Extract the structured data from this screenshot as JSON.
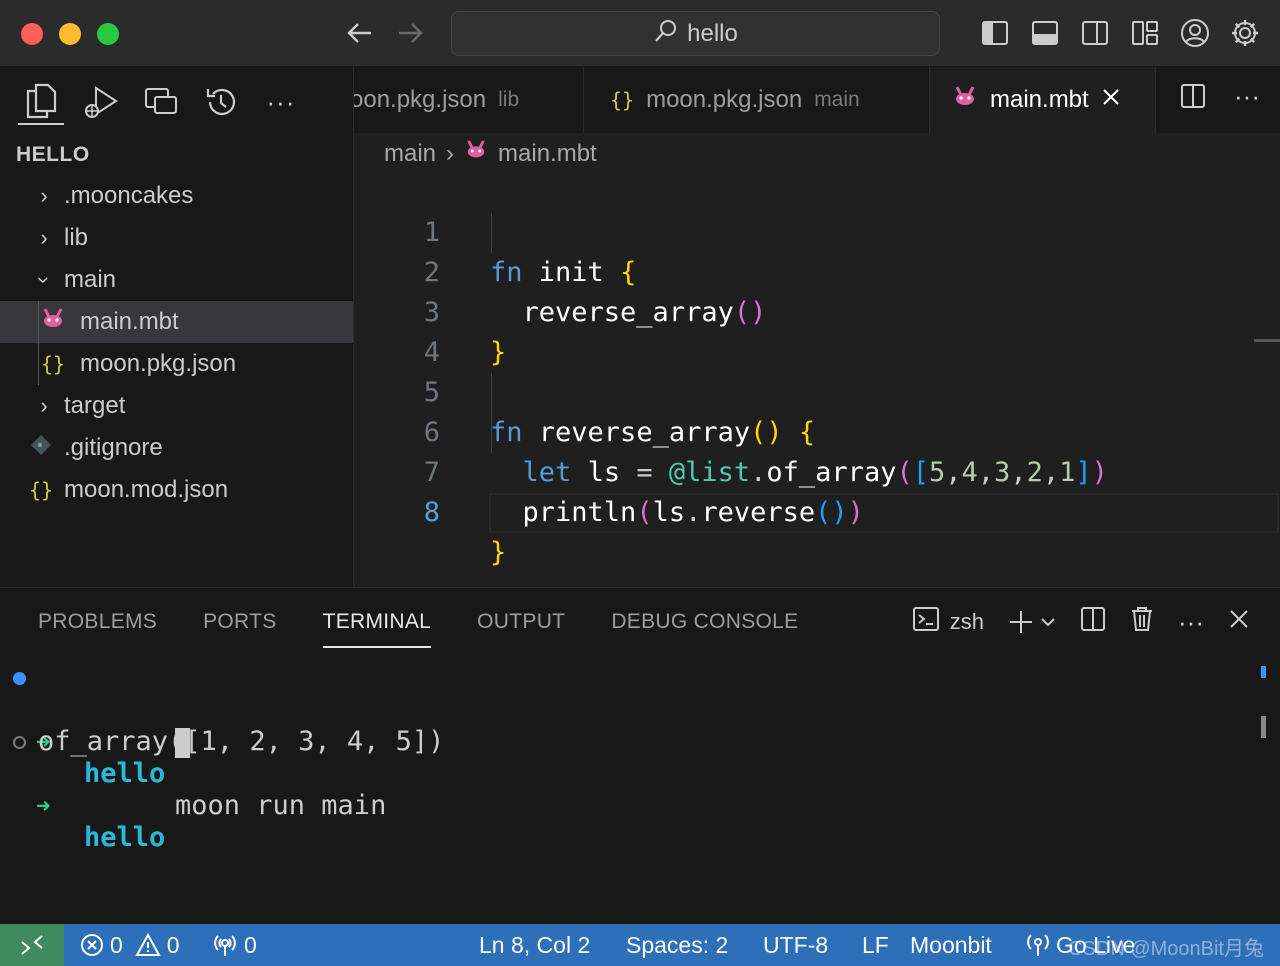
{
  "titlebar": {
    "search_text": "hello",
    "icons": [
      "toggle-primary-sidebar-icon",
      "toggle-panel-icon",
      "toggle-secondary-sidebar-icon",
      "customize-layout-icon",
      "account-icon",
      "settings-gear-icon"
    ]
  },
  "activity_bar": {
    "icons": [
      "explorer-icon",
      "run-debug-icon",
      "remote-explorer-icon",
      "timeline-icon",
      "more-icon"
    ]
  },
  "explorer": {
    "title": "HELLO",
    "items": [
      {
        "label": ".mooncakes",
        "type": "folder",
        "expanded": false
      },
      {
        "label": "lib",
        "type": "folder",
        "expanded": false
      },
      {
        "label": "main",
        "type": "folder",
        "expanded": true
      },
      {
        "label": "main.mbt",
        "type": "moonbit-file",
        "selected": true
      },
      {
        "label": "moon.pkg.json",
        "type": "json-file"
      },
      {
        "label": "target",
        "type": "folder",
        "expanded": false
      },
      {
        "label": ".gitignore",
        "type": "git-file"
      },
      {
        "label": "moon.mod.json",
        "type": "json-file"
      }
    ]
  },
  "tabs": [
    {
      "label": "oon.pkg.json",
      "desc": "lib"
    },
    {
      "label": "moon.pkg.json",
      "desc": "main"
    },
    {
      "label": "main.mbt",
      "desc": ""
    }
  ],
  "breadcrumb": {
    "folder": "main",
    "file": "main.mbt"
  },
  "editor": {
    "line_numbers": [
      "1",
      "2",
      "3",
      "4",
      "5",
      "6",
      "7",
      "8"
    ],
    "active_line": "8"
  },
  "panel": {
    "tabs": [
      "PROBLEMS",
      "PORTS",
      "TERMINAL",
      "OUTPUT",
      "DEBUG CONSOLE"
    ],
    "active_tab": "TERMINAL",
    "shell": "zsh",
    "terminal": {
      "prompt_arrow": "➜",
      "dir": "hello",
      "command": "moon run main",
      "output": "of_array([1, 2, 3, 4, 5])"
    }
  },
  "statusbar": {
    "errors": "0",
    "warnings": "0",
    "ports": "0",
    "position": "Ln 8, Col 2",
    "spaces": "Spaces: 2",
    "encoding": "UTF-8",
    "eol": "LF",
    "language": "Moonbit",
    "golive": "Go Live",
    "watermark": "CSDN @MoonBit月兔"
  },
  "colors": {
    "accent": "#3794ff",
    "status_bar": "#2d6fb8",
    "remote": "#3f8b5f"
  }
}
